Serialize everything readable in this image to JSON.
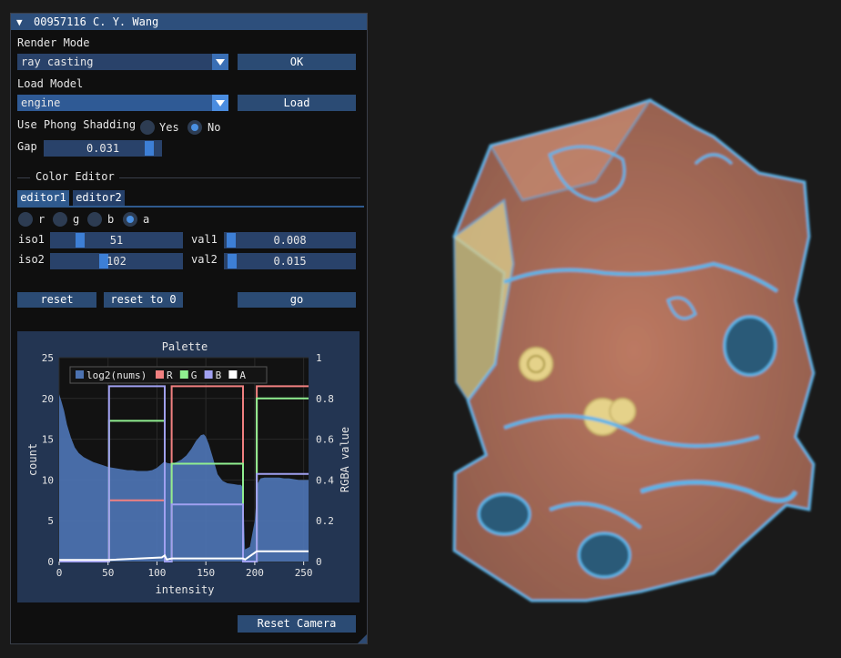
{
  "window": {
    "title": "00957116 C. Y. Wang",
    "collapse_icon": "triangle-down"
  },
  "render_mode": {
    "label": "Render Mode",
    "value": "ray casting",
    "button": "OK"
  },
  "load_model": {
    "label": "Load Model",
    "value": "engine",
    "button": "Load"
  },
  "phong": {
    "label": "Use Phong Shadding",
    "yes": "Yes",
    "no": "No",
    "selected": "No"
  },
  "gap": {
    "label": "Gap",
    "value": "0.031",
    "fraction": 0.93
  },
  "color_editor": {
    "header": "Color Editor",
    "tabs": [
      "editor1",
      "editor2"
    ],
    "active_tab": "editor1",
    "channels": [
      "r",
      "g",
      "b",
      "a"
    ],
    "selected_channel": "a",
    "iso1": {
      "label": "iso1",
      "value": "51",
      "fraction": 0.2
    },
    "iso2": {
      "label": "iso2",
      "value": "102",
      "fraction": 0.4
    },
    "val1": {
      "label": "val1",
      "value": "0.008",
      "fraction": 0.008
    },
    "val2": {
      "label": "val2",
      "value": "0.015",
      "fraction": 0.015
    },
    "reset": "reset",
    "reset_to_0": "reset to 0",
    "go": "go"
  },
  "reset_camera": "Reset Camera",
  "chart_data": {
    "type": "area",
    "title": "Palette",
    "xlabel": "intensity",
    "ylabel": "count",
    "y2label": "RGBA value",
    "xlim": [
      0,
      255
    ],
    "ylim": [
      0,
      25
    ],
    "y2lim": [
      0,
      1
    ],
    "xticks": [
      0,
      50,
      100,
      150,
      200,
      250
    ],
    "yticks": [
      0,
      5,
      10,
      15,
      20,
      25
    ],
    "y2ticks": [
      0,
      0.2,
      0.4,
      0.6,
      0.8,
      1
    ],
    "legend": [
      "log2(nums)",
      "R",
      "G",
      "B",
      "A"
    ],
    "legend_position": "top-left",
    "colors": {
      "hist": "#4c72b0",
      "R": "#f08080",
      "G": "#90ee90",
      "B": "#a0a0f0",
      "A": "#ffffff"
    },
    "histogram": {
      "x": [
        0,
        2,
        5,
        8,
        12,
        16,
        20,
        25,
        30,
        35,
        40,
        45,
        50,
        55,
        60,
        65,
        70,
        75,
        80,
        85,
        90,
        95,
        100,
        105,
        108,
        110,
        115,
        120,
        125,
        130,
        135,
        140,
        145,
        148,
        150,
        153,
        157,
        162,
        167,
        172,
        178,
        183,
        186,
        188,
        190,
        195,
        200,
        203,
        206,
        210,
        215,
        220,
        225,
        230,
        235,
        240,
        245,
        250,
        253,
        255
      ],
      "y": [
        20.5,
        19.8,
        18.5,
        16.8,
        15.2,
        14.0,
        13.3,
        12.8,
        12.5,
        12.2,
        12.0,
        11.8,
        11.6,
        11.5,
        11.4,
        11.3,
        11.2,
        11.2,
        11.1,
        11.1,
        11.1,
        11.2,
        11.5,
        12.0,
        12.3,
        12.1,
        12.0,
        12.2,
        12.5,
        13.0,
        13.8,
        14.8,
        15.5,
        15.6,
        15.3,
        14.4,
        12.8,
        10.7,
        9.9,
        9.6,
        9.5,
        9.4,
        9.4,
        9.0,
        1.5,
        1.8,
        5.0,
        9.6,
        10.2,
        10.3,
        10.3,
        10.3,
        10.3,
        10.2,
        10.2,
        10.1,
        10.0,
        10.0,
        10.0,
        10.0
      ]
    },
    "series": [
      {
        "name": "R",
        "x": [
          0,
          51,
          51,
          108,
          108,
          115,
          115,
          188,
          188,
          202,
          202,
          255
        ],
        "y": [
          0,
          0,
          0.3,
          0.3,
          0,
          0,
          0.86,
          0.86,
          0,
          0,
          0.86,
          0.86
        ]
      },
      {
        "name": "G",
        "x": [
          0,
          51,
          51,
          108,
          108,
          115,
          115,
          188,
          188,
          202,
          202,
          255
        ],
        "y": [
          0,
          0,
          0.69,
          0.69,
          0,
          0,
          0.48,
          0.48,
          0,
          0,
          0.8,
          0.8
        ]
      },
      {
        "name": "B",
        "x": [
          0,
          51,
          51,
          108,
          108,
          115,
          115,
          188,
          188,
          202,
          202,
          255
        ],
        "y": [
          0,
          0,
          0.86,
          0.86,
          0,
          0,
          0.28,
          0.28,
          0,
          0,
          0.43,
          0.43
        ]
      },
      {
        "name": "A",
        "x": [
          0,
          51,
          105,
          108,
          110,
          115,
          188,
          190,
          202,
          255
        ],
        "y": [
          0.008,
          0.008,
          0.02,
          0.03,
          0.01,
          0.015,
          0.015,
          0.01,
          0.05,
          0.05
        ]
      }
    ]
  }
}
